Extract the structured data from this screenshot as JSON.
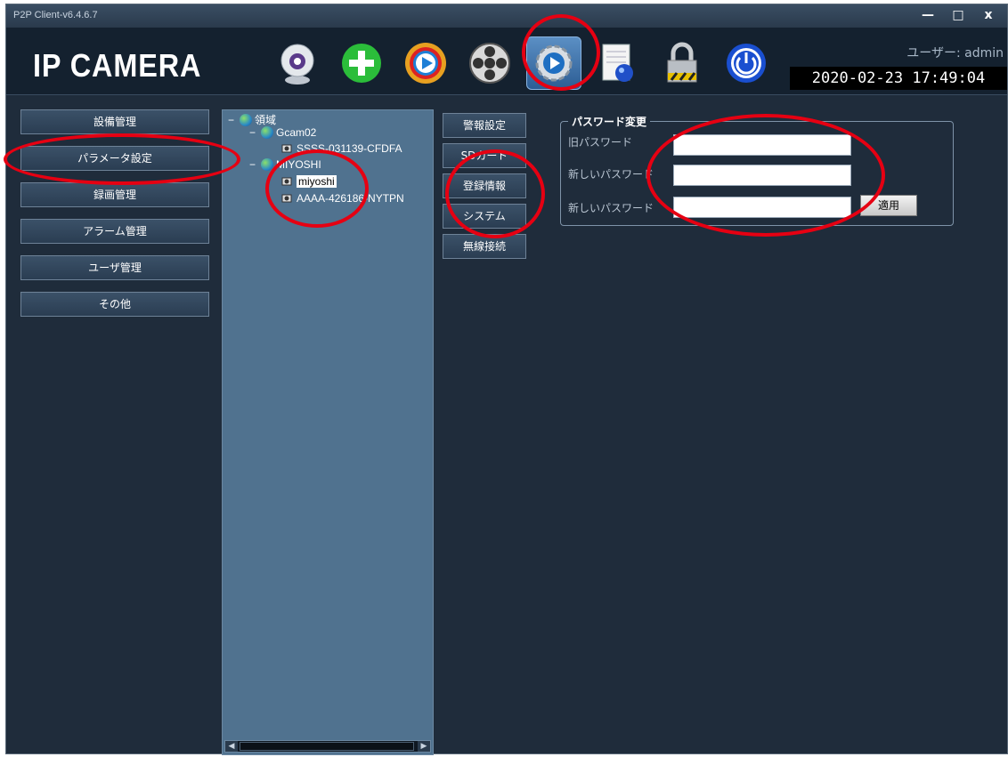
{
  "window": {
    "title": "P2P Client-v6.4.6.7",
    "controls": [
      "—",
      "□",
      "x"
    ]
  },
  "header": {
    "logo": "IP CAMERA",
    "user": "ユーザー: admin",
    "datetime": "2020-02-23  17:49:04",
    "toolbar": [
      {
        "name": "webcam-icon"
      },
      {
        "name": "add-icon"
      },
      {
        "name": "play-icon"
      },
      {
        "name": "film-reel-icon"
      },
      {
        "name": "settings-icon",
        "active": true
      },
      {
        "name": "document-icon"
      },
      {
        "name": "lock-icon"
      },
      {
        "name": "power-icon"
      }
    ]
  },
  "nav": {
    "items": [
      "設備管理",
      "パラメータ設定",
      "録画管理",
      "アラーム管理",
      "ユーザ管理",
      "その他"
    ]
  },
  "tree": {
    "root": "領域",
    "group1": "Gcam02",
    "group1_device": "SSSS-031139-CFDFA",
    "group2": "MIYOSHI",
    "group2_device1": "miyoshi",
    "group2_device2": "AAAA-426186-NYTPN",
    "scroll_left": "◀",
    "scroll_right": "▶"
  },
  "sub": {
    "items": [
      "警報設定",
      "SDカード",
      "登録情報",
      "システム",
      "無線接続"
    ]
  },
  "password": {
    "legend": "パスワード変更",
    "old_label": "旧パスワード",
    "new_label": "新しいパスワード",
    "confirm_label": "新しいパスワード",
    "apply": "適用"
  },
  "annotation_color": "#e60012"
}
